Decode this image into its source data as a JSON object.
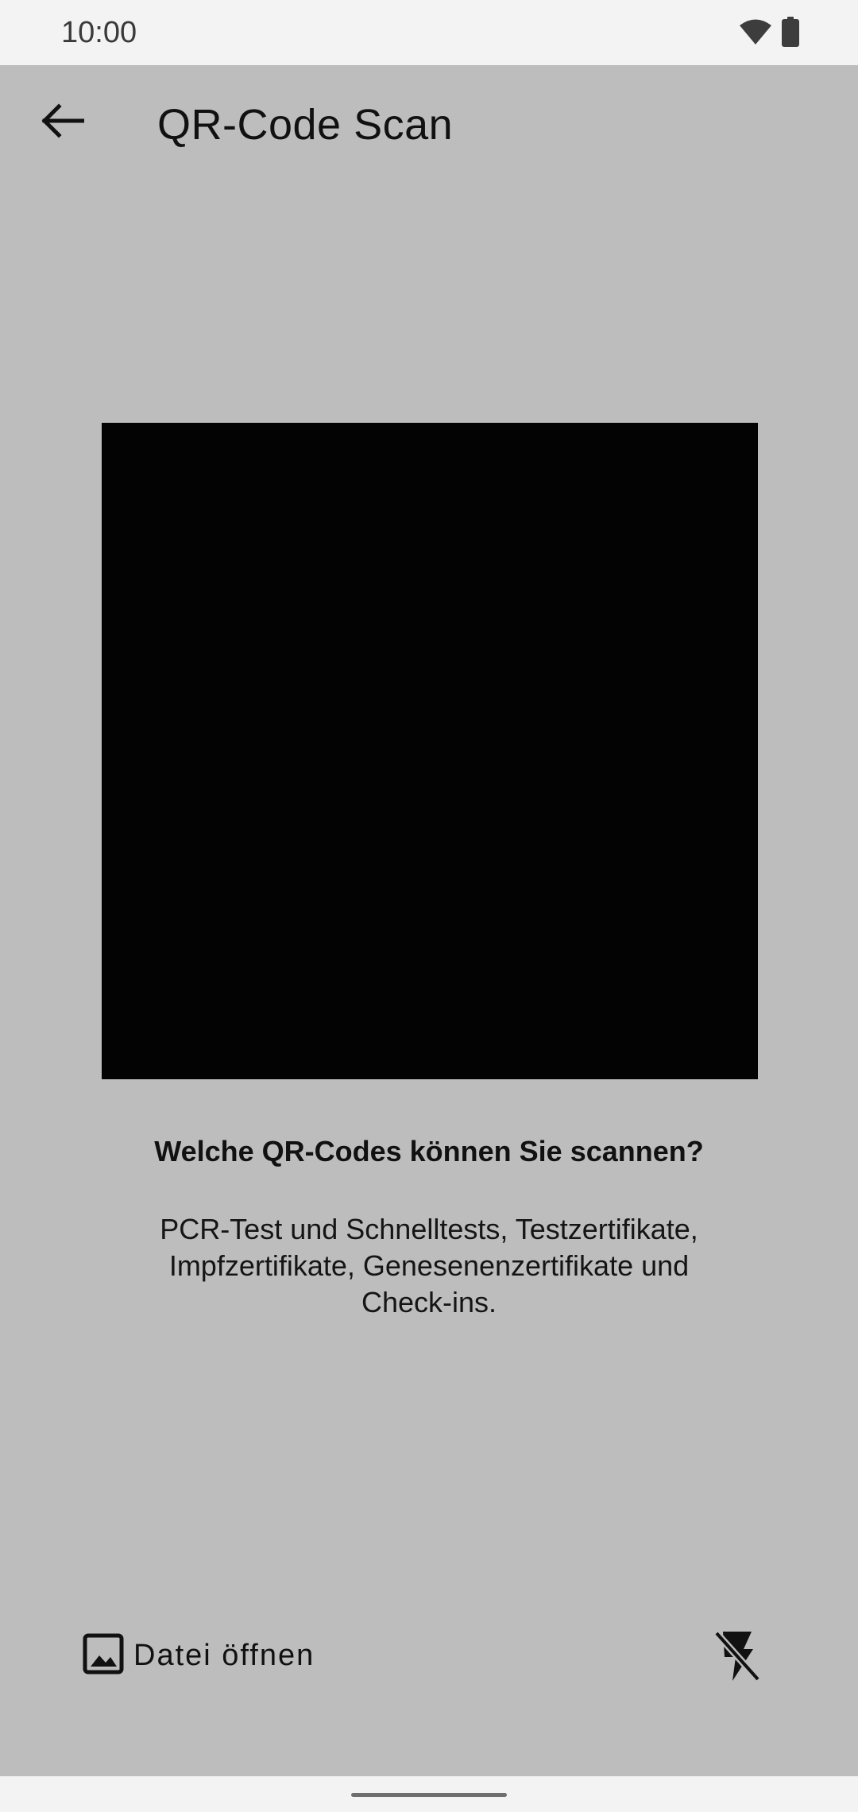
{
  "status_bar": {
    "time": "10:00",
    "icons": [
      "wifi-icon",
      "battery-icon"
    ]
  },
  "app_bar": {
    "back_icon": "arrow-back-icon",
    "title": "QR-Code Scan"
  },
  "scanner": {
    "camera_preview_color": "#030303"
  },
  "info": {
    "heading": "Welche QR-Codes können Sie scannen?",
    "body_lines": [
      "PCR-Test und Schnelltests, Testzertifikate,",
      "Impfzertifikate, Genesenenzertifikate und",
      "Check-ins."
    ]
  },
  "actions": {
    "open_file_icon": "image-icon",
    "open_file_label": "Datei öffnen",
    "flash_icon": "flash-off-icon"
  },
  "colors": {
    "background": "#bdbdbd",
    "system_bars": "#f3f3f3"
  }
}
